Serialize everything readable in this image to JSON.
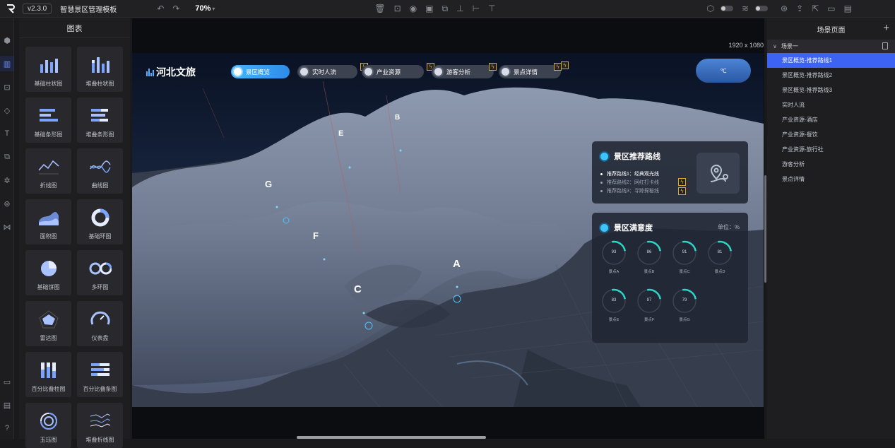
{
  "app": {
    "version": "v2.3.0",
    "title": "智慧景区管理模板",
    "zoom": "70%"
  },
  "left_panel": {
    "title": "图表",
    "items": [
      {
        "label": "基础柱状图",
        "icon": "bar-chart-icon"
      },
      {
        "label": "堆叠柱状图",
        "icon": "stacked-bar-chart-icon"
      },
      {
        "label": "基础条形图",
        "icon": "horizontal-bar-chart-icon"
      },
      {
        "label": "堆叠条形图",
        "icon": "stacked-horizontal-bar-icon"
      },
      {
        "label": "折线图",
        "icon": "line-chart-icon"
      },
      {
        "label": "曲线图",
        "icon": "curve-chart-icon"
      },
      {
        "label": "面积图",
        "icon": "area-chart-icon"
      },
      {
        "label": "基础环图",
        "icon": "donut-chart-icon"
      },
      {
        "label": "基础饼图",
        "icon": "pie-chart-icon"
      },
      {
        "label": "多环图",
        "icon": "multi-ring-chart-icon"
      },
      {
        "label": "雷达图",
        "icon": "radar-chart-icon"
      },
      {
        "label": "仪表盘",
        "icon": "gauge-chart-icon"
      },
      {
        "label": "百分比叠柱图",
        "icon": "percent-stacked-bar-icon"
      },
      {
        "label": "百分比叠条图",
        "icon": "percent-stacked-hbar-icon"
      },
      {
        "label": "玉珏图",
        "icon": "radial-bar-icon"
      },
      {
        "label": "堆叠折线图",
        "icon": "stacked-line-chart-icon"
      }
    ]
  },
  "canvas": {
    "resolution": "1920 x 1080"
  },
  "scene": {
    "brand": "河北文旅",
    "nav": [
      "景区概览",
      "实时人流",
      "产业资源",
      "游客分析",
      "景点详情"
    ],
    "weather": "℃",
    "map_labels": [
      "A",
      "B",
      "C",
      "E",
      "F",
      "G"
    ],
    "route_card": {
      "title": "景区推荐路线",
      "routes": [
        "推荐路线1：经典观光线",
        "推荐路线2：网红打卡线",
        "推荐路线3：寻踪探秘线"
      ]
    },
    "satisfaction_card": {
      "title": "景区满意度",
      "unit": "单位：%",
      "gauges": [
        {
          "label": "景点A",
          "value": 93
        },
        {
          "label": "景点B",
          "value": 86
        },
        {
          "label": "景点C",
          "value": 91
        },
        {
          "label": "景点D",
          "value": 81
        },
        {
          "label": "景点E",
          "value": 83
        },
        {
          "label": "景点F",
          "value": 97
        },
        {
          "label": "景点G",
          "value": 79
        }
      ]
    }
  },
  "right_panel": {
    "title": "场景页面",
    "group": "场景一",
    "pages": [
      "景区概览-推荐路线1",
      "景区概览-推荐路线2",
      "景区概览-推荐路线3",
      "实时人流",
      "产业资源-酒店",
      "产业资源-餐饮",
      "产业资源-旅行社",
      "游客分析",
      "景点详情"
    ]
  }
}
